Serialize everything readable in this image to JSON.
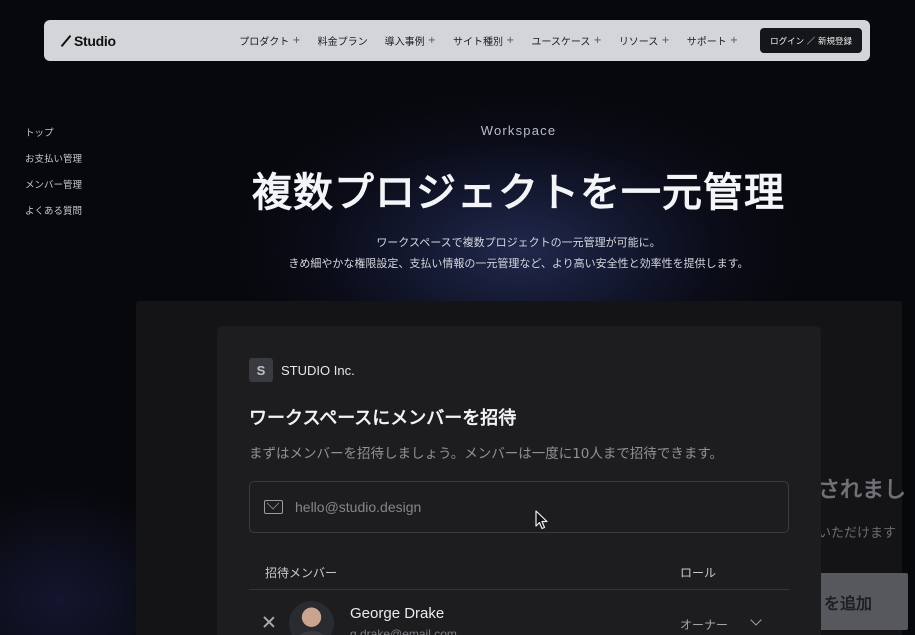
{
  "header": {
    "logo_text": "Studio",
    "nav": [
      {
        "label": "プロダクト",
        "plus": "+"
      },
      {
        "label": "料金プラン",
        "plus": ""
      },
      {
        "label": "導入事例",
        "plus": "+"
      },
      {
        "label": "サイト種別",
        "plus": "+"
      },
      {
        "label": "ユースケース",
        "plus": "+"
      },
      {
        "label": "リソース",
        "plus": "+"
      },
      {
        "label": "サポート",
        "plus": "+"
      }
    ],
    "login_label": "ログイン ／ 新規登録"
  },
  "sidenav": [
    {
      "label": "トップ"
    },
    {
      "label": "お支払い管理"
    },
    {
      "label": "メンバー管理"
    },
    {
      "label": "よくある質問"
    }
  ],
  "hero": {
    "eyebrow": "Workspace",
    "headline": "複数プロジェクトを一元管理",
    "sub_line1": "ワークスペースで複数プロジェクトの一元管理が可能に。",
    "sub_line2": "きめ細やかな権限設定、支払い情報の一元管理など、より高い安全性と効率性を提供します。"
  },
  "card": {
    "org_initial": "S",
    "org_name": "STUDIO Inc.",
    "title": "ワークスペースにメンバーを招待",
    "description": "まずはメンバーを招待しましょう。メンバーは一度に10人まで招待できます。",
    "email_placeholder": "hello@studio.design",
    "col_members": "招待メンバー",
    "col_role": "ロール",
    "members": [
      {
        "name": "George Drake",
        "email": "g.drake@email.com",
        "role": "オーナー"
      }
    ]
  },
  "behind_card": {
    "title": "されまし",
    "subtitle": "いただけます",
    "button_label": "を追加"
  },
  "colors": {
    "background": "#07080c",
    "header_bg": "#d4d5d9",
    "card_bg": "#1d1d20",
    "login_btn_bg": "#15161a"
  }
}
